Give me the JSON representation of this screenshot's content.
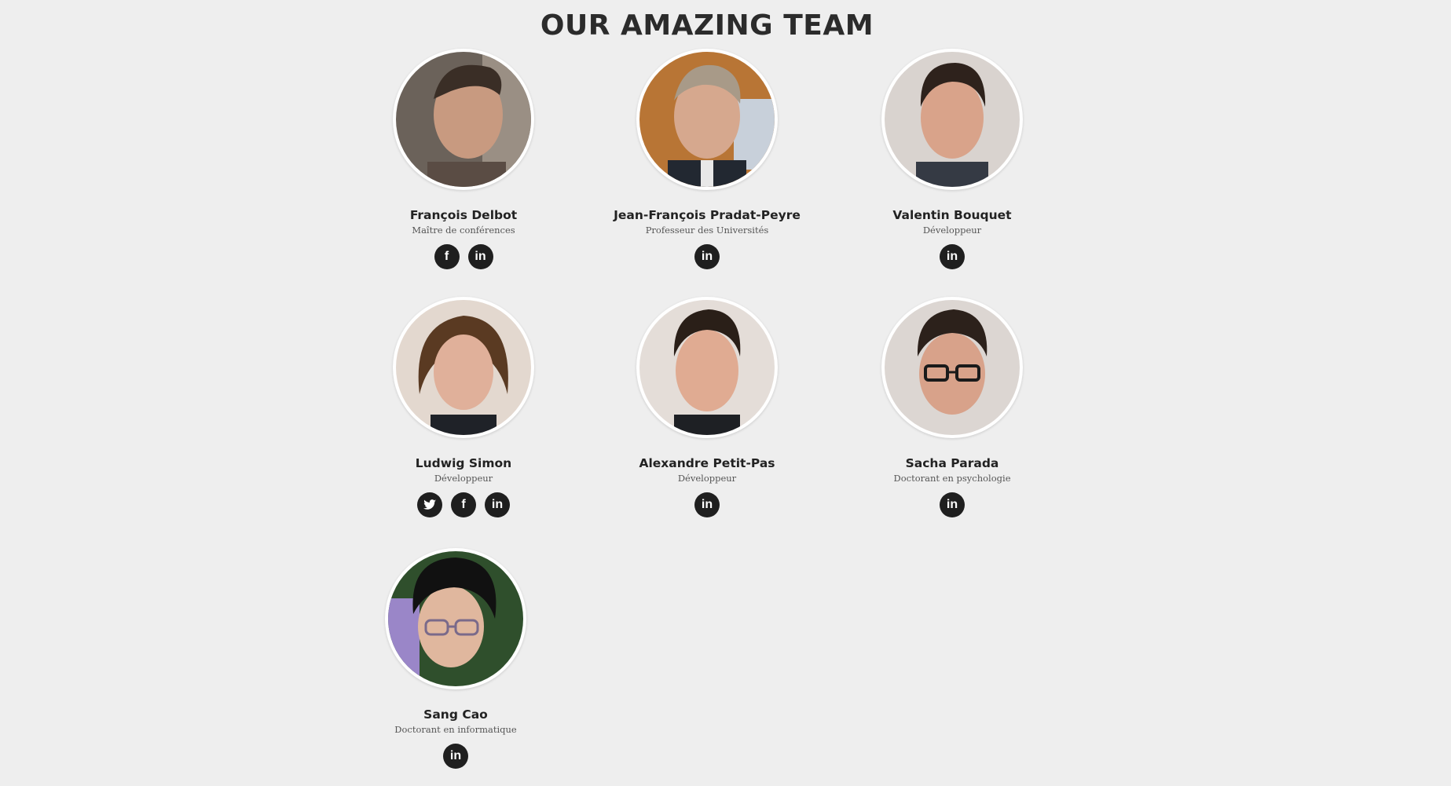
{
  "header": {
    "title": "OUR AMAZING TEAM"
  },
  "icons": {
    "facebook": "f",
    "linkedin": "in",
    "twitter": "bird"
  },
  "colors": {
    "background": "#eeeeee",
    "social_bg": "#1f1f1f",
    "text": "#222222"
  },
  "members": [
    {
      "name": "François Delbot",
      "role": "Maître de conférences",
      "socials": [
        "facebook-icon",
        "linkedin-icon"
      ]
    },
    {
      "name": "Jean-François Pradat-Peyre",
      "role": "Professeur des Universités",
      "socials": [
        "linkedin-icon"
      ]
    },
    {
      "name": "Valentin Bouquet",
      "role": "Développeur",
      "socials": [
        "linkedin-icon"
      ]
    },
    {
      "name": "Ludwig Simon",
      "role": "Développeur",
      "socials": [
        "twitter-icon",
        "facebook-icon",
        "linkedin-icon"
      ]
    },
    {
      "name": "Alexandre Petit-Pas",
      "role": "Développeur",
      "socials": [
        "linkedin-icon"
      ]
    },
    {
      "name": "Sacha Parada",
      "role": "Doctorant en psychologie",
      "socials": [
        "linkedin-icon"
      ]
    },
    {
      "name": "Sang Cao",
      "role": "Doctorant en informatique",
      "socials": [
        "linkedin-icon"
      ]
    }
  ]
}
